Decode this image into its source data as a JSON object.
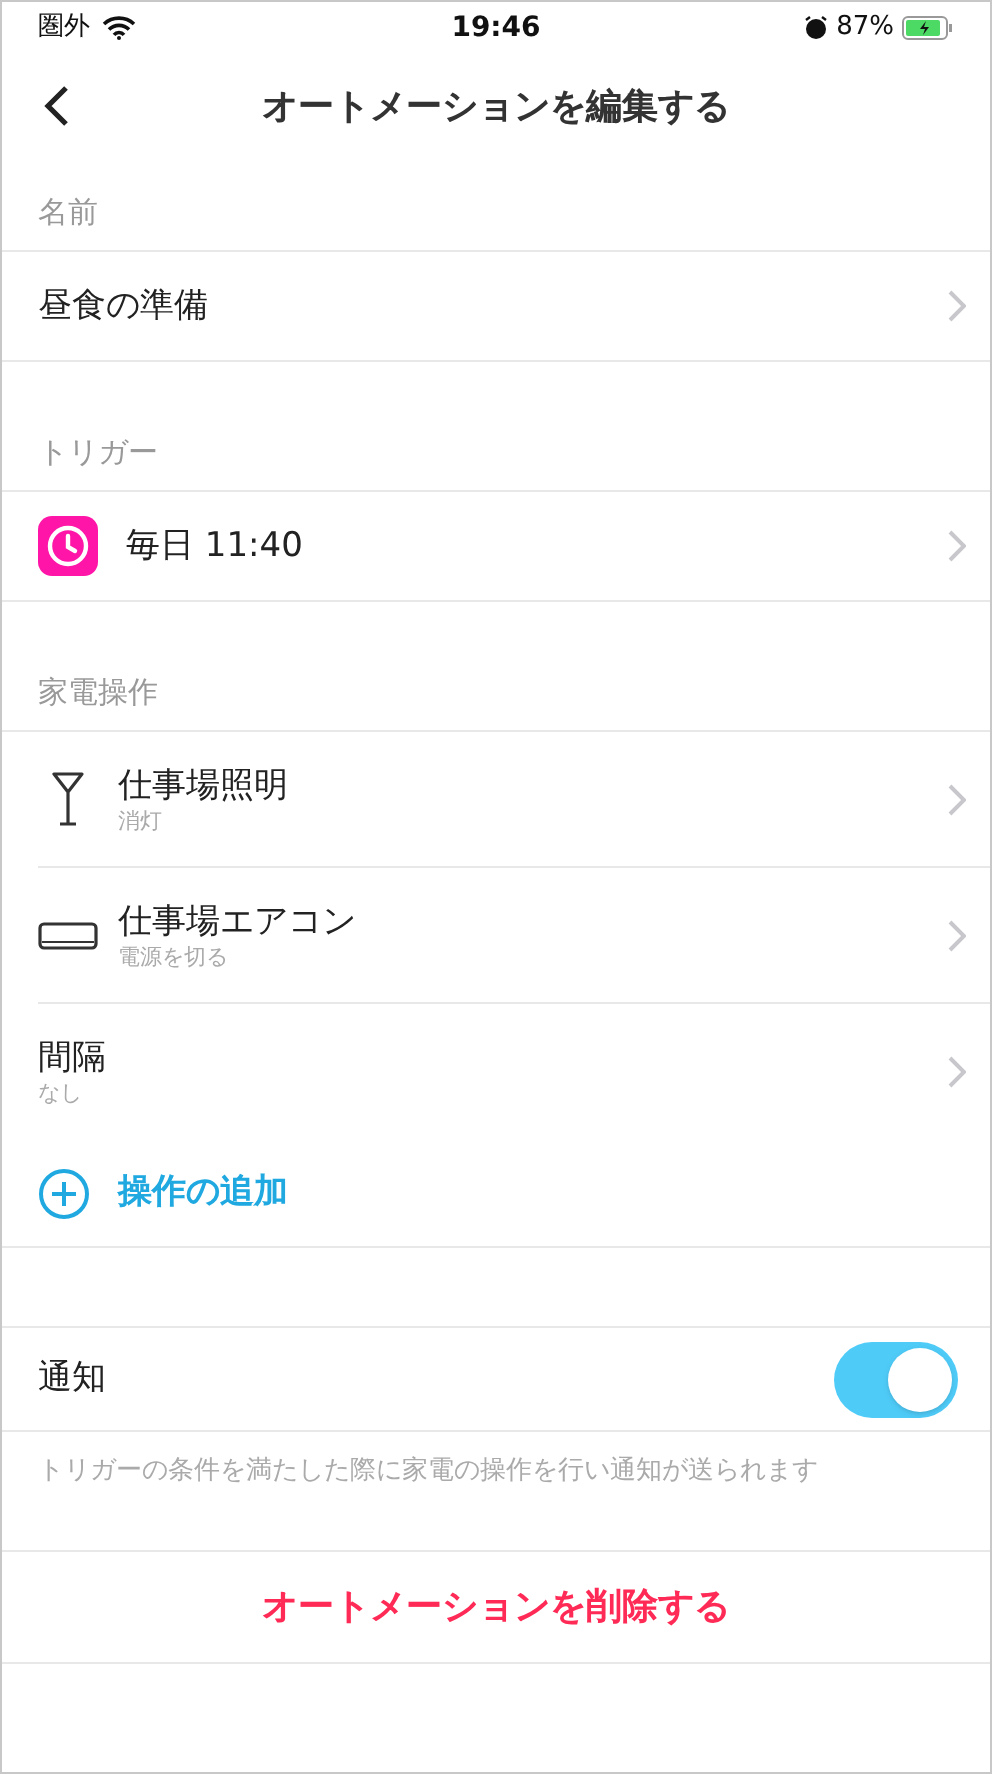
{
  "status_bar": {
    "carrier": "圏外",
    "time": "19:46",
    "battery": "87%"
  },
  "nav": {
    "title": "オートメーションを編集する"
  },
  "sections": [
    {
      "header": "名前",
      "items": [
        {
          "kind": "plain",
          "label": "昼食の準備"
        }
      ]
    },
    {
      "header": "トリガー",
      "items": [
        {
          "kind": "trigger",
          "label": "毎日 11:40"
        }
      ]
    },
    {
      "header": "家電操作",
      "items": [
        {
          "kind": "lamp",
          "label": "仕事場照明",
          "sublabel": "消灯"
        },
        {
          "kind": "aircon",
          "label": "仕事場エアコン",
          "sublabel": "電源を切る"
        },
        {
          "kind": "interval",
          "label": "間隔",
          "sublabel": "なし"
        },
        {
          "kind": "add",
          "label": "操作の追加"
        }
      ]
    }
  ],
  "notification": {
    "label": "通知",
    "on": true,
    "note": "トリガーの条件を満たした際に家電の操作を行い通知が送られます"
  },
  "delete_button": "オートメーションを削除する"
}
